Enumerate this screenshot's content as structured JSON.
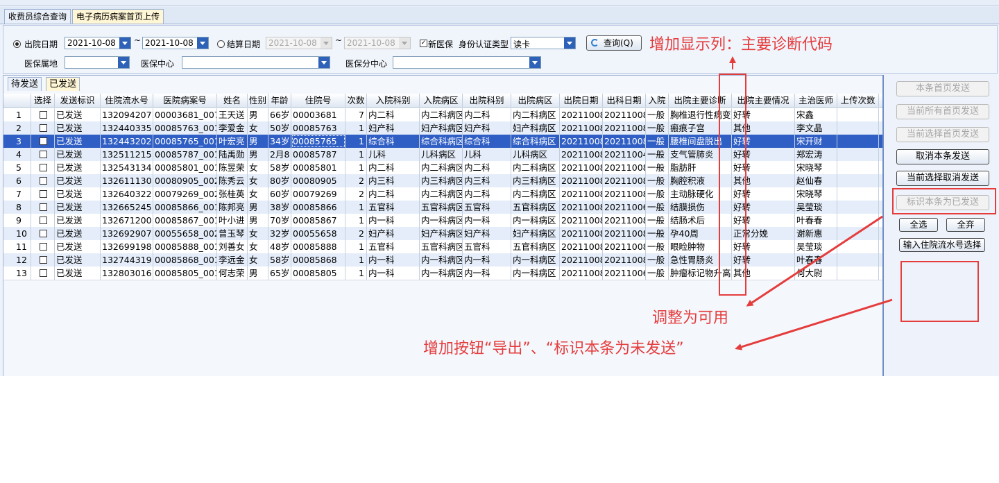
{
  "main_tabs": [
    {
      "label": "收费员综合查询",
      "active": false
    },
    {
      "label": "电子病历病案首页上传",
      "active": true
    }
  ],
  "filters": {
    "discharge_date_label": "出院日期",
    "discharge_from": "2021-10-08",
    "range_sep": "~",
    "discharge_to": "2021-10-08",
    "settle_date_label": "结算日期",
    "settle_from": "2021-10-08",
    "settle_to": "2021-10-08",
    "new_insurance_label": "新医保",
    "id_type_label": "身份认证类型",
    "id_type_value": "读卡",
    "query_button": "查询(Q)",
    "insured_place_label": "医保属地",
    "insurance_center_label": "医保中心",
    "insurance_subcenter_label": "医保分中心"
  },
  "sub_tabs": [
    {
      "label": "待发送",
      "active": false
    },
    {
      "label": "已发送",
      "active": true
    }
  ],
  "columns": [
    "选择",
    "发送标识",
    "住院流水号",
    "医院病案号",
    "姓名",
    "性别",
    "年龄",
    "住院号",
    "次数",
    "入院科别",
    "入院病区",
    "出院科别",
    "出院病区",
    "出院日期",
    "出科日期",
    "入院",
    "出院主要诊断",
    "出院主要情况",
    "主治医师",
    "上传次数"
  ],
  "rows": [
    [
      "1",
      "",
      "已发送",
      "132094207",
      "00003681_007",
      "王天送",
      "男",
      "66岁",
      "00003681",
      "7",
      "内二科",
      "内二科病区",
      "内二科",
      "内二科病区",
      "20211008",
      "20211008",
      "一般",
      "胸椎退行性病变",
      "好转",
      "宋鑫",
      ""
    ],
    [
      "2",
      "",
      "已发送",
      "132440335",
      "00085763_001",
      "李爱金",
      "女",
      "50岁",
      "00085763",
      "1",
      "妇产科",
      "妇产科病区",
      "妇产科",
      "妇产科病区",
      "20211008",
      "20211008",
      "一般",
      "瘢痕子宫",
      "其他",
      "李文晶",
      ""
    ],
    [
      "3",
      "",
      "已发送",
      "132443202",
      "00085765_001",
      "叶宏亮",
      "男",
      "34岁",
      "00085765",
      "1",
      "综合科",
      "综合科病区",
      "综合科",
      "综合科病区",
      "20211008",
      "20211008",
      "一般",
      "腰椎间盘脱出",
      "好转",
      "宋开财",
      ""
    ],
    [
      "4",
      "",
      "已发送",
      "132511215",
      "00085787_001",
      "陆禹勋",
      "男",
      "2月8",
      "00085787",
      "1",
      "儿科",
      "儿科病区",
      "儿科",
      "儿科病区",
      "20211008",
      "20211004",
      "一般",
      "支气管肺炎",
      "好转",
      "郑宏涛",
      ""
    ],
    [
      "5",
      "",
      "已发送",
      "132543134",
      "00085801_001",
      "陈昱荣",
      "女",
      "58岁",
      "00085801",
      "1",
      "内二科",
      "内二科病区",
      "内二科",
      "内二科病区",
      "20211008",
      "20211008",
      "一般",
      "脂肪肝",
      "好转",
      "宋晓琴",
      ""
    ],
    [
      "6",
      "",
      "已发送",
      "132611130",
      "00080905_002",
      "陈秀云",
      "女",
      "80岁",
      "00080905",
      "2",
      "内三科",
      "内三科病区",
      "内三科",
      "内三科病区",
      "20211008",
      "20211008",
      "一般",
      "胸腔积液",
      "其他",
      "赵仙春",
      ""
    ],
    [
      "7",
      "",
      "已发送",
      "132640322",
      "00079269_002",
      "张桂英",
      "女",
      "60岁",
      "00079269",
      "2",
      "内二科",
      "内二科病区",
      "内二科",
      "内二科病区",
      "20211008",
      "20211008",
      "一般",
      "主动脉硬化",
      "好转",
      "宋晓琴",
      ""
    ],
    [
      "8",
      "",
      "已发送",
      "132665245",
      "00085866_001",
      "陈邦亮",
      "男",
      "38岁",
      "00085866",
      "1",
      "五官科",
      "五官科病区",
      "五官科",
      "五官科病区",
      "20211008",
      "20211006",
      "一般",
      "结膜损伤",
      "好转",
      "吴莹琰",
      ""
    ],
    [
      "9",
      "",
      "已发送",
      "132671200",
      "00085867_001",
      "叶小进",
      "男",
      "70岁",
      "00085867",
      "1",
      "内一科",
      "内一科病区",
      "内一科",
      "内一科病区",
      "20211008",
      "20211008",
      "一般",
      "结肠术后",
      "好转",
      "叶春春",
      ""
    ],
    [
      "10",
      "",
      "已发送",
      "132692907",
      "00055658_002",
      "曾玉琴",
      "女",
      "32岁",
      "00055658",
      "2",
      "妇产科",
      "妇产科病区",
      "妇产科",
      "妇产科病区",
      "20211008",
      "20211008",
      "一般",
      "孕40周",
      "正常分娩",
      "谢新惠",
      ""
    ],
    [
      "11",
      "",
      "已发送",
      "132699198",
      "00085888_001",
      "刘善女",
      "女",
      "48岁",
      "00085888",
      "1",
      "五官科",
      "五官科病区",
      "五官科",
      "五官科病区",
      "20211008",
      "20211008",
      "一般",
      "眼睑肿物",
      "好转",
      "吴莹琰",
      ""
    ],
    [
      "12",
      "",
      "已发送",
      "132744319",
      "00085868_001",
      "李远金",
      "女",
      "58岁",
      "00085868",
      "1",
      "内一科",
      "内一科病区",
      "内一科",
      "内一科病区",
      "20211008",
      "20211008",
      "一般",
      "急性胃肠炎",
      "好转",
      "叶春春",
      ""
    ],
    [
      "13",
      "",
      "已发送",
      "132803016",
      "00085805_001",
      "何志荣",
      "男",
      "65岁",
      "00085805",
      "1",
      "内一科",
      "内一科病区",
      "内一科",
      "内一科病区",
      "20211008",
      "20211006",
      "一般",
      "肿瘤标记物升高",
      "其他",
      "何大尉",
      ""
    ]
  ],
  "selected_row_index": 2,
  "right_buttons": [
    {
      "label": "本条首页发送",
      "enabled": false
    },
    {
      "label": "当前所有首页发送",
      "enabled": false
    },
    {
      "label": "当前选择首页发送",
      "enabled": false
    },
    {
      "label": "取消本条发送",
      "enabled": true
    },
    {
      "label": "当前选择取消发送",
      "enabled": true
    },
    {
      "label": "标识本条为已发送",
      "enabled": false
    },
    {
      "label": "全选",
      "enabled": true
    },
    {
      "label": "全弃",
      "enabled": true
    },
    {
      "label": "输入住院流水号选择",
      "enabled": true
    }
  ],
  "annotations": {
    "add_column": "增加显示列：主要诊断代码",
    "make_enabled": "调整为可用",
    "add_buttons": "增加按钮“导出”、“标识本条为未发送”"
  },
  "colors": {
    "annotation_red": "#e53c3c",
    "selection_blue": "#2f5ec4",
    "active_tab": "#fff6d5"
  }
}
